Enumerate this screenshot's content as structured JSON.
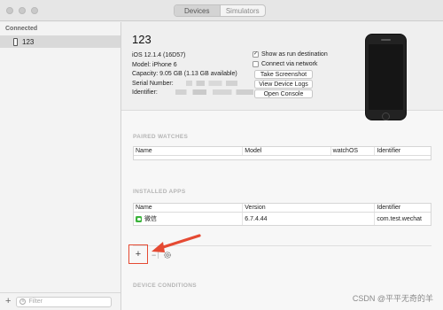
{
  "window": {
    "tabs": [
      "Devices",
      "Simulators"
    ],
    "active_tab": "Devices"
  },
  "sidebar": {
    "header": "Connected",
    "items": [
      {
        "label": "123"
      }
    ],
    "add_label": "+",
    "filter_placeholder": "Filter"
  },
  "device": {
    "name": "123",
    "ios": "iOS 12.1.4 (16D57)",
    "model": "Model: iPhone 6",
    "capacity": "Capacity: 9.05 GB (1.13 GB available)",
    "serial_label": "Serial Number:",
    "identifier_label": "Identifier:"
  },
  "options": {
    "show_run_destination": {
      "label": "Show as run destination",
      "checked": true
    },
    "connect_network": {
      "label": "Connect via network",
      "checked": false
    }
  },
  "buttons": {
    "take_screenshot": "Take Screenshot",
    "view_logs": "View Device Logs",
    "open_console": "Open Console"
  },
  "paired_watches": {
    "title": "PAIRED WATCHES",
    "columns": [
      "Name",
      "Model",
      "watchOS",
      "Identifier"
    ]
  },
  "installed_apps": {
    "title": "INSTALLED APPS",
    "columns": [
      "Name",
      "Version",
      "Identifier"
    ],
    "rows": [
      {
        "name": "微信",
        "version": "6.7.4.44",
        "identifier": "com.test.wechat"
      }
    ]
  },
  "app_toolbar": {
    "add": "+",
    "remove": "−"
  },
  "device_conditions": {
    "title": "DEVICE CONDITIONS"
  },
  "watermark": "CSDN @平平无奇的羊",
  "colors": {
    "highlight_red": "#e54a33",
    "wechat_green": "#3bb33b"
  }
}
